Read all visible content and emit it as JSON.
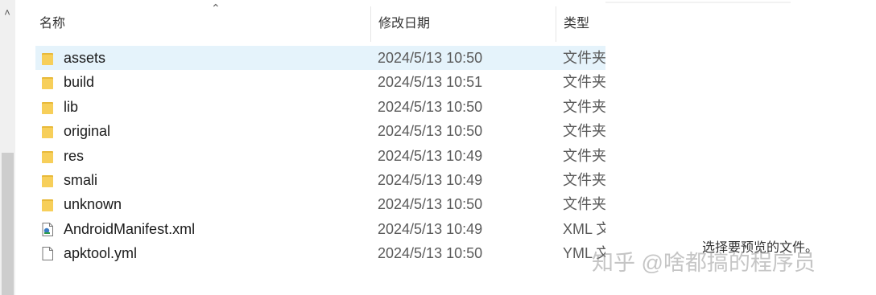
{
  "columns": {
    "name": "名称",
    "date": "修改日期",
    "type": "类型"
  },
  "files": [
    {
      "name": "assets",
      "date": "2024/5/13 10:50",
      "type": "文件夹",
      "kind": "folder",
      "selected": true
    },
    {
      "name": "build",
      "date": "2024/5/13 10:51",
      "type": "文件夹",
      "kind": "folder"
    },
    {
      "name": "lib",
      "date": "2024/5/13 10:50",
      "type": "文件夹",
      "kind": "folder"
    },
    {
      "name": "original",
      "date": "2024/5/13 10:50",
      "type": "文件夹",
      "kind": "folder"
    },
    {
      "name": "res",
      "date": "2024/5/13 10:49",
      "type": "文件夹",
      "kind": "folder"
    },
    {
      "name": "smali",
      "date": "2024/5/13 10:49",
      "type": "文件夹",
      "kind": "folder"
    },
    {
      "name": "unknown",
      "date": "2024/5/13 10:50",
      "type": "文件夹",
      "kind": "folder"
    },
    {
      "name": "AndroidManifest.xml",
      "date": "2024/5/13 10:49",
      "type": "XML 文",
      "kind": "xml-file"
    },
    {
      "name": "apktool.yml",
      "date": "2024/5/13 10:50",
      "type": "YML 文",
      "kind": "file"
    }
  ],
  "preview": {
    "message": "选择要预览的文件。"
  },
  "watermark": "知乎 @啥都搞的程序员",
  "icons": {
    "sort": "chevron-up-icon",
    "scroll_up": "arrow-up-icon"
  },
  "colors": {
    "selected_row": "#e5f3fb",
    "folder": "#f5c542"
  }
}
